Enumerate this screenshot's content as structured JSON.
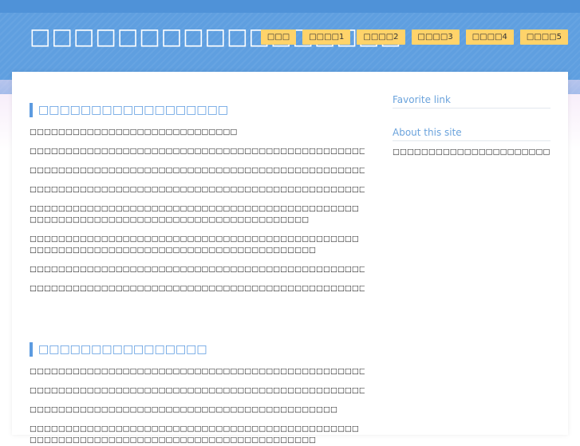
{
  "header": {
    "site_title": "□□□□□□□□□□□□□□□□□",
    "nav": [
      "□□□",
      "□□□□1",
      "□□□□2",
      "□□□□3",
      "□□□□4",
      "□□□□5"
    ],
    "colors": {
      "header_bg": "#5f9fe0",
      "nav_bg": "#ffd36a",
      "accent": "#5c9be0"
    }
  },
  "main": {
    "sections": [
      {
        "heading": "□□□□□□□□□□□□□□□□□□",
        "paragraphs": [
          "□□□□□□□□□□□□□□□□□□□□□□□□□□□□□",
          "□□□□□□□□□□□□□□□□□□□□□□□□□□□□□□□□□□□□□□□□□□□□□□□□□□□□□□□□□□□□□□□□□□□□",
          "□□□□□□□□□□□□□□□□□□□□□□□□□□□□□□□□□□□□□□□□□□□□□□□",
          "□□□□□□□□□□□□□□□□□□□□□□□□□□□□□□□□□□□□□□□□□□□□□□□□□□□□□□□□□□□□□",
          "□□□□□□□□□□□□□□□□□□□□□□□□□□□□□□□□□□□□□□□□□□□□□□□□□□□□□□□□□□□□□□□□□□□□□□□□□□□□□□□□□□□□□",
          "□□□□□□□□□□□□□□□□□□□□□□□□□□□□□□□□□□□□□□□□□□□□□□□□□□□□□□□□□□□□□□□□□□□□□□□□□□□□□□□□□□□□□□",
          "□□□□□□□□□□□□□□□□□□□□□□□□□□□□□□□□□□□□□□□□□□□□□□□□□□□□□□□□□□□□□□□",
          "□□□□□□□□□□□□□□□□□□□□□□□□□□□□□□□□□□□□□□□□□□□□□□□□□□□□□□□"
        ]
      },
      {
        "heading": "□□□□□□□□□□□□□□□□",
        "paragraphs": [
          "□□□□□□□□□□□□□□□□□□□□□□□□□□□□□□□□□□□□□□□□□□□□□□□□□□□□□□□□□□",
          "□□□□□□□□□□□□□□□□□□□□□□□□□□□□□□□□□□□□□□□□□□□□□□□□□□□□□□□□□□",
          "□□□□□□□□□□□□□□□□□□□□□□□□□□□□□□□□□□□□□□□□□□□",
          "□□□□□□□□□□□□□□□□□□□□□□□□□□□□□□□□□□□□□□□□□□□□□□□□□□□□□□□□□□□□□□□□□□□□□□□□□□□□□□□□□□□□□□"
        ]
      }
    ]
  },
  "sidebar": {
    "favorite_title": "Favorite link",
    "about_title": "About this site",
    "about_text": "□□□□□□□□□□□□□□□□□□□□□□□□□□□□□□□□□□"
  }
}
